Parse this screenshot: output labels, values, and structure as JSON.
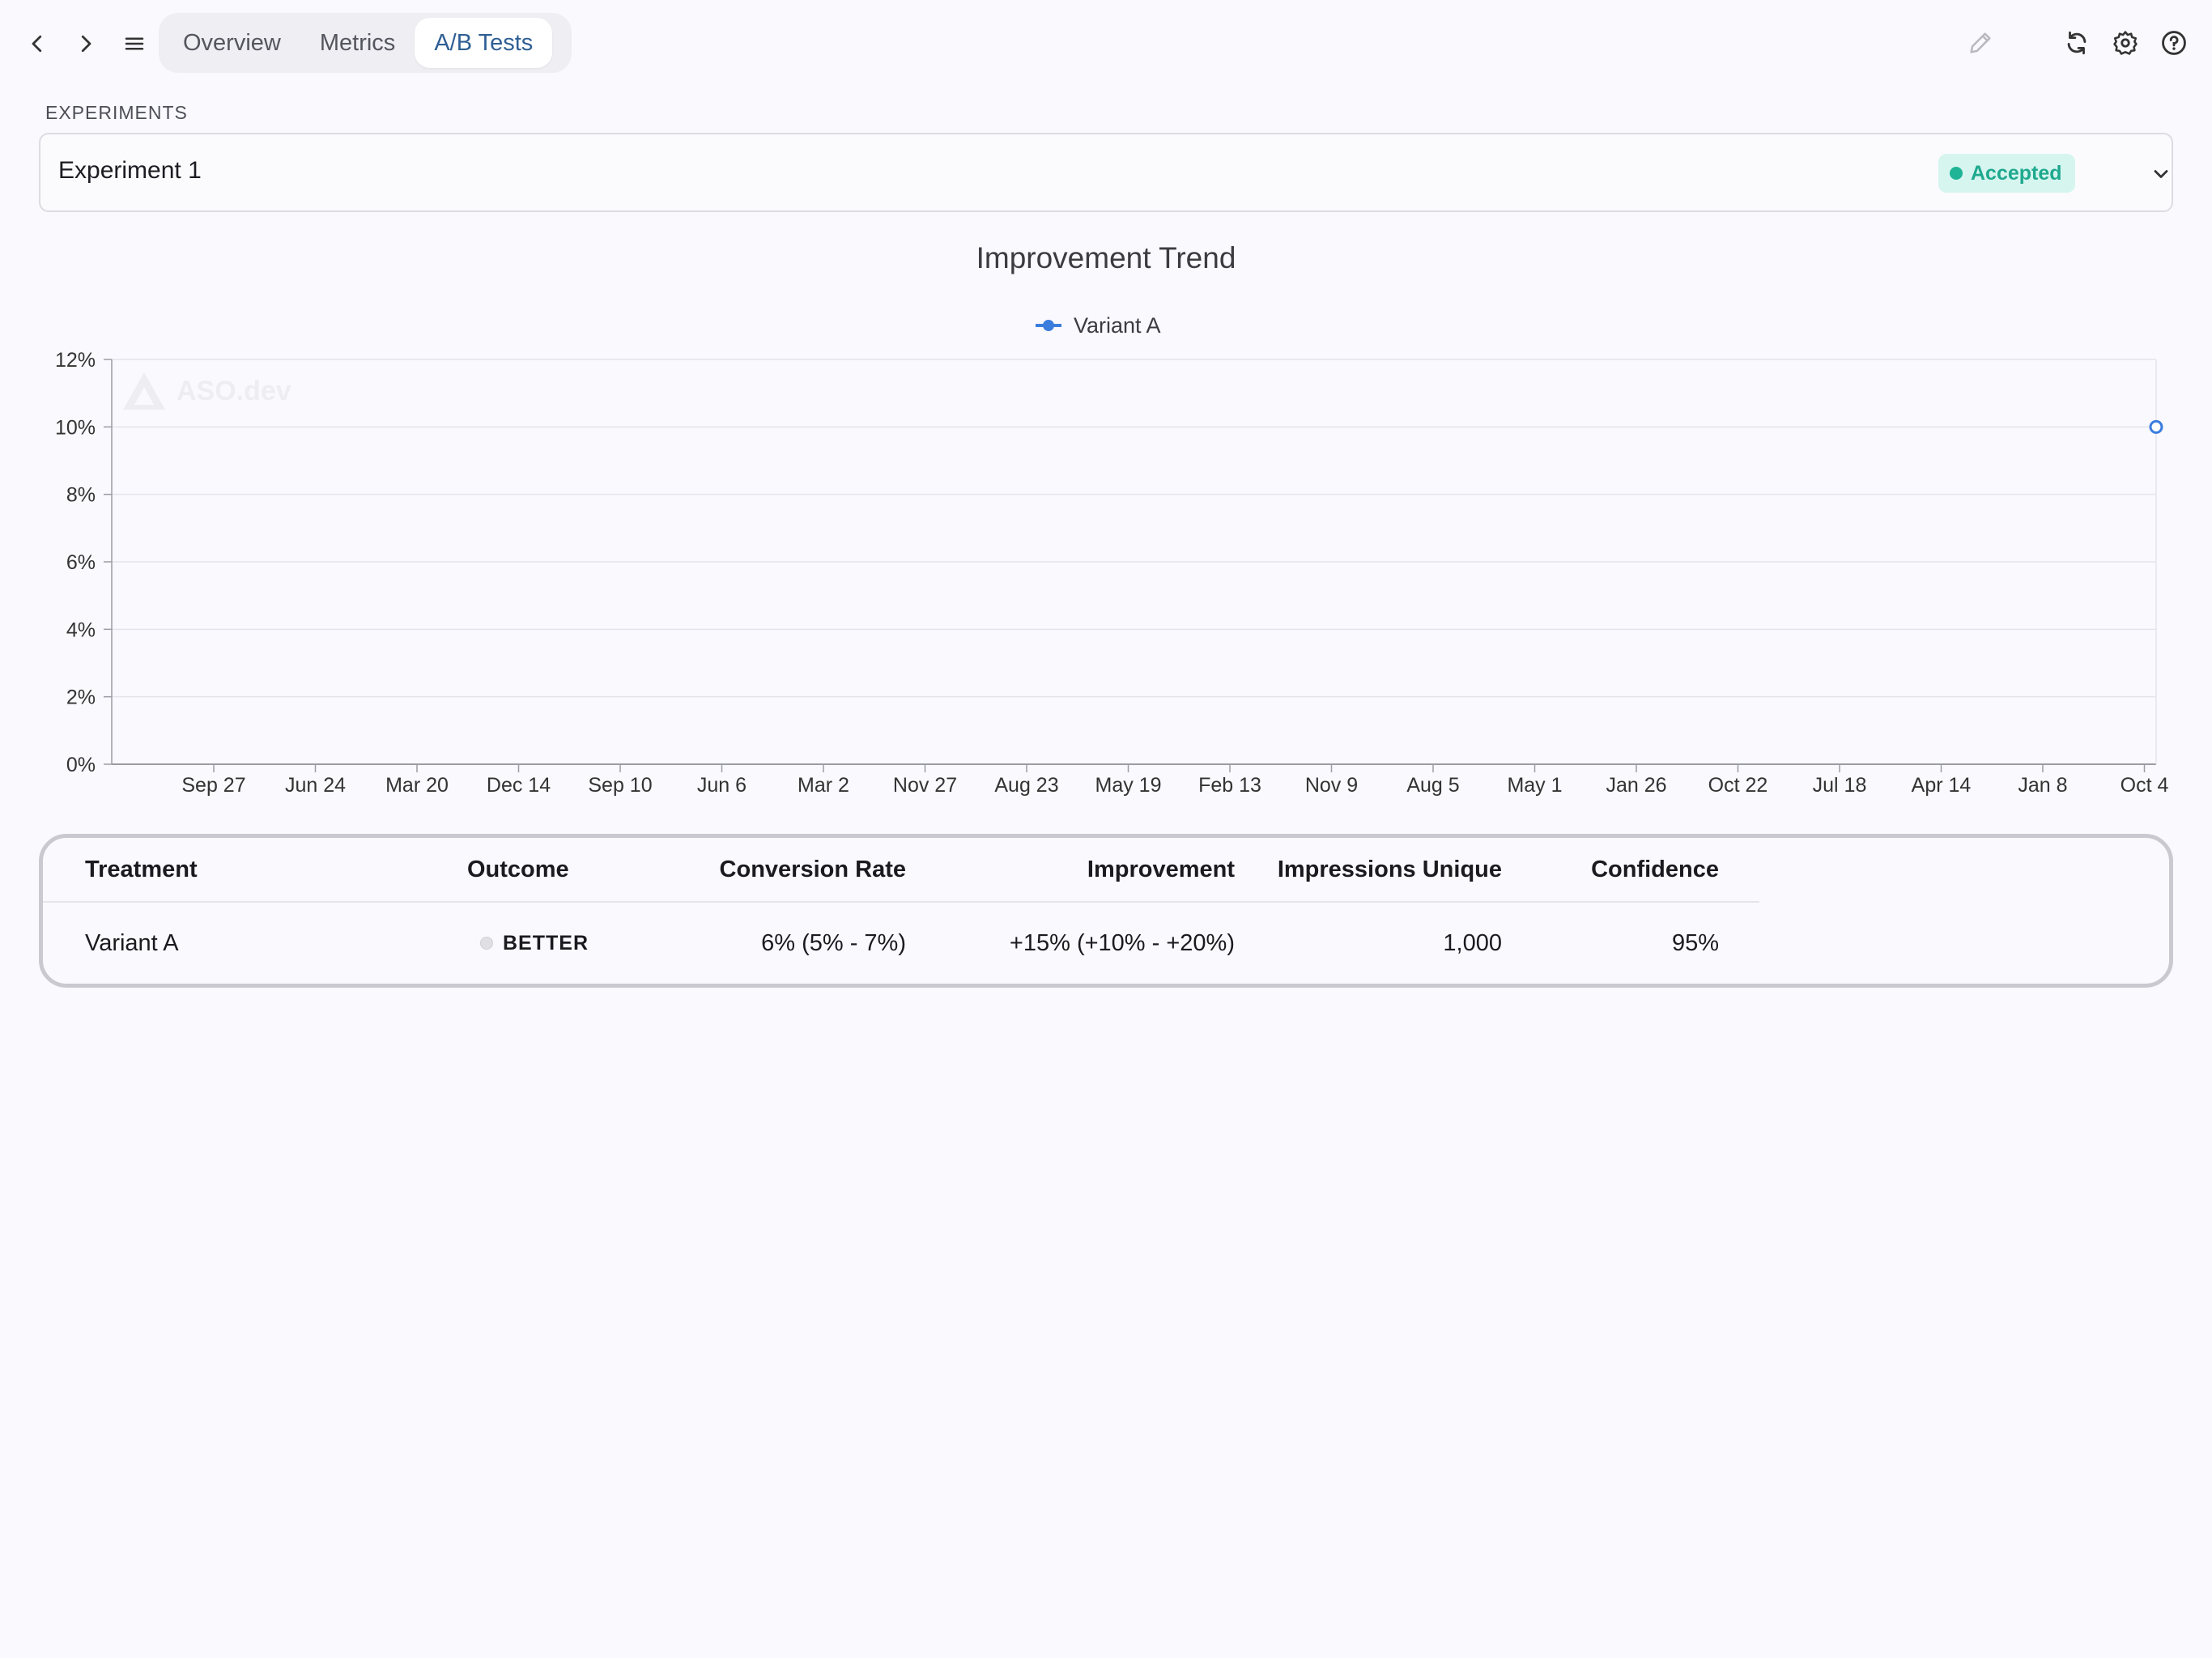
{
  "toolbar": {
    "tabs": [
      {
        "label": "Overview",
        "active": false
      },
      {
        "label": "Metrics",
        "active": false
      },
      {
        "label": "A/B Tests",
        "active": true
      }
    ]
  },
  "experiments": {
    "section_label": "EXPERIMENTS",
    "selected": "Experiment 1",
    "status": "Accepted",
    "status_color": "#1fb496"
  },
  "chart_data": {
    "type": "line",
    "title": "Improvement Trend",
    "xlabel": "",
    "ylabel": "",
    "x_ticks": [
      "Sep 27",
      "Jun 24",
      "Mar 20",
      "Dec 14",
      "Sep 10",
      "Jun 6",
      "Mar 2",
      "Nov 27",
      "Aug 23",
      "May 19",
      "Feb 13",
      "Nov 9",
      "Aug 5",
      "May 1",
      "Jan 26",
      "Oct 22",
      "Jul 18",
      "Apr 14",
      "Jan 8",
      "Oct 4"
    ],
    "y_ticks": [
      "0%",
      "2%",
      "4%",
      "6%",
      "8%",
      "10%",
      "12%"
    ],
    "ylim": [
      0,
      12
    ],
    "grid": true,
    "legend_position": "top-center",
    "series": [
      {
        "name": "Variant A",
        "color": "#3b7ddd",
        "points": [
          {
            "x": "Oct 4",
            "y": 10
          }
        ]
      }
    ],
    "watermark": "ASO.dev"
  },
  "results": {
    "headers": [
      "Treatment",
      "Outcome",
      "Conversion Rate",
      "Improvement",
      "Impressions Unique",
      "Confidence"
    ],
    "rows": [
      {
        "treatment": "Variant A",
        "outcome": "BETTER",
        "conversion_rate": "6% (5% - 7%)",
        "improvement": "+15% (+10% - +20%)",
        "impressions_unique": "1,000",
        "confidence": "95%"
      }
    ]
  }
}
